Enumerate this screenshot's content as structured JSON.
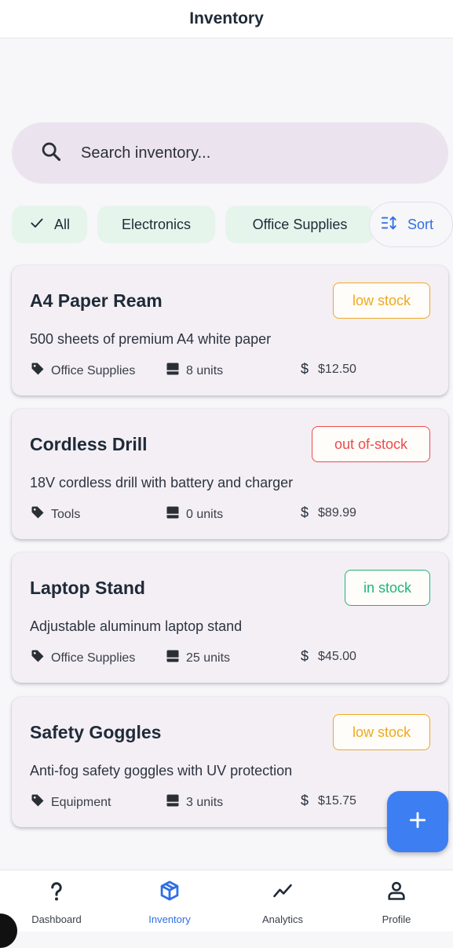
{
  "header": {
    "title": "Inventory"
  },
  "search": {
    "placeholder": "Search inventory...",
    "value": ""
  },
  "filters": {
    "chips": [
      {
        "label": "All",
        "selected": true
      },
      {
        "label": "Electronics",
        "selected": false
      },
      {
        "label": "Office Supplies",
        "selected": false
      }
    ],
    "sort_label": "Sort"
  },
  "items": [
    {
      "name": "A4 Paper Ream",
      "status": "low stock",
      "description": "500 sheets of premium A4 white paper",
      "category": "Office Supplies",
      "quantity": "8 units",
      "price": "$12.50"
    },
    {
      "name": "Cordless Drill",
      "status": "out of-stock",
      "description": "18V cordless drill with battery and charger",
      "category": "Tools",
      "quantity": "0 units",
      "price": "$89.99"
    },
    {
      "name": "Laptop Stand",
      "status": "in stock",
      "description": "Adjustable aluminum laptop stand",
      "category": "Office Supplies",
      "quantity": "25 units",
      "price": "$45.00"
    },
    {
      "name": "Safety Goggles",
      "status": "low stock",
      "description": "Anti-fog safety goggles with UV protection",
      "category": "Equipment",
      "quantity": "3 units",
      "price": "$15.75"
    }
  ],
  "status_colors": {
    "low stock": "#f0a81d",
    "out of-stock": "#ee4b4b",
    "in stock": "#1fb57a"
  },
  "fab": {
    "icon": "plus-icon"
  },
  "nav": [
    {
      "label": "Dashboard",
      "icon": "question-icon",
      "active": false
    },
    {
      "label": "Inventory",
      "icon": "box-icon",
      "active": true
    },
    {
      "label": "Analytics",
      "icon": "trend-icon",
      "active": false
    },
    {
      "label": "Profile",
      "icon": "person-icon",
      "active": false
    }
  ],
  "colors": {
    "accent": "#2f6fe4",
    "fab": "#3d7ff2",
    "chip_bg": "#e6f5ec",
    "search_bg": "#ebe4ef",
    "card_bg": "#f3eff5"
  }
}
